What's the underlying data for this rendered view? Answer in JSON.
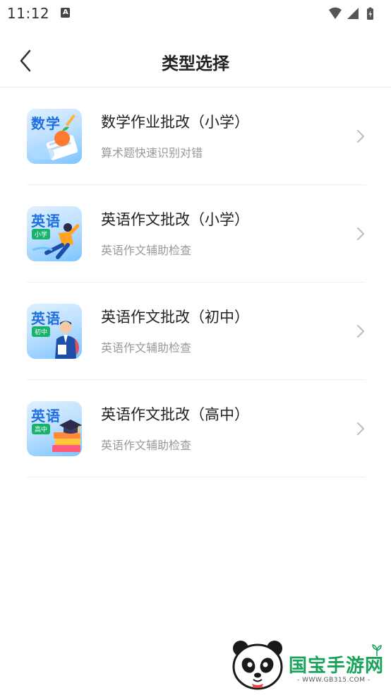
{
  "status_bar": {
    "time": "11:12",
    "notification_glyph": "A"
  },
  "header": {
    "title": "类型选择",
    "back_icon": "chevron-left-icon"
  },
  "types": [
    {
      "icon_text": "数学",
      "icon_badge": "",
      "title": "数学作业批改（小学）",
      "subtitle": "算术题快速识别对错"
    },
    {
      "icon_text": "英语",
      "icon_badge": "小学",
      "title": "英语作文批改（小学）",
      "subtitle": "英语作文辅助检查"
    },
    {
      "icon_text": "英语",
      "icon_badge": "初中",
      "title": "英语作文批改（初中）",
      "subtitle": "英语作文辅助检查"
    },
    {
      "icon_text": "英语",
      "icon_badge": "高中",
      "title": "英语作文批改（高中）",
      "subtitle": "英语作文辅助检查"
    }
  ],
  "watermark": {
    "title": "国宝手游网",
    "url": "- WWW.GB315.COM -"
  },
  "colors": {
    "accent_blue": "#1f6fe0",
    "badge_green": "#17b36b",
    "watermark_green": "#1aa35a"
  }
}
